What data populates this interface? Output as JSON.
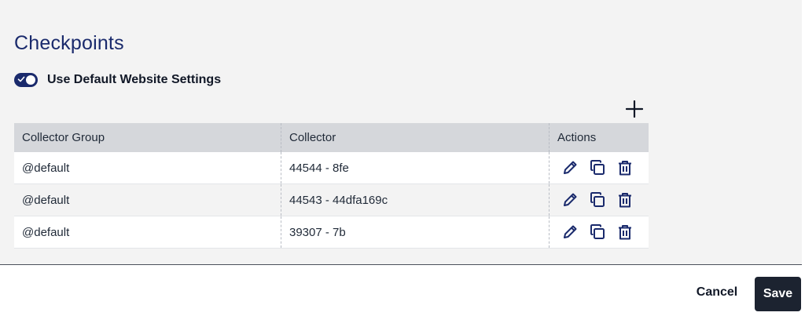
{
  "section": {
    "title": "Checkpoints",
    "toggle": {
      "label": "Use Default Website Settings",
      "checked": true
    }
  },
  "table": {
    "columns": [
      "Collector Group",
      "Collector",
      "Actions"
    ],
    "rows": [
      {
        "group": "@default",
        "collector": "44544 - 8fe"
      },
      {
        "group": "@default",
        "collector": "44543 - 44dfa169c"
      },
      {
        "group": "@default",
        "collector": "39307 - 7b"
      }
    ],
    "action_icons": [
      "pencil-icon",
      "copy-icon",
      "trash-icon"
    ]
  },
  "footer": {
    "cancel_label": "Cancel",
    "save_label": "Save"
  },
  "colors": {
    "accent": "#1a2a6c",
    "save_bg": "#1c2330",
    "header_bg": "#d5d7db",
    "panel_bg": "#f3f3f3"
  }
}
